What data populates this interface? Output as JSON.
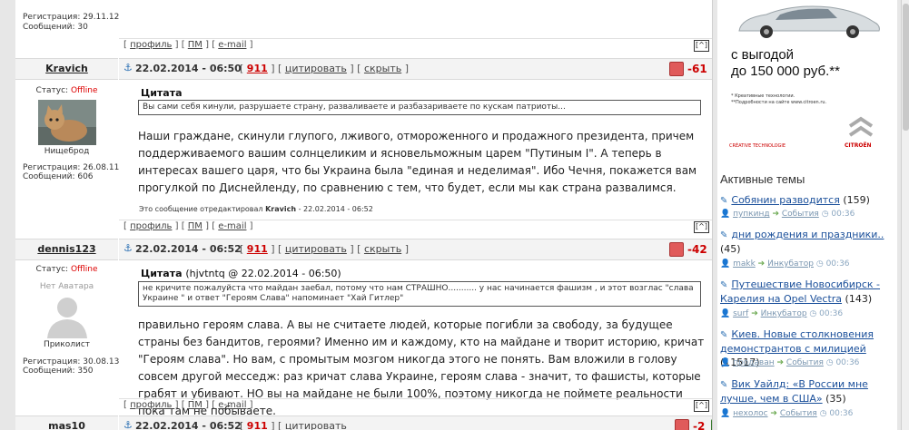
{
  "post0": {
    "reg": "Регистрация: 29.11.12",
    "msgs": "Сообщений: 30",
    "footer": {
      "profile": "профиль",
      "pm": "ПМ",
      "email": "e-mail"
    },
    "totop": "[^]"
  },
  "post1": {
    "user": "Kravich",
    "status_label": "Статус:",
    "status": "Offline",
    "rank": "Нищеброд",
    "reg": "Регистрация: 26.08.11",
    "msgs": "Сообщений: 606",
    "date": "22.02.2014 - 06:50",
    "num": "911",
    "quote_btn": "цитировать",
    "hide_btn": "скрыть",
    "rating": "-61",
    "quote_title": "Цитата",
    "quote_text": "Вы сами себя кинули, разрушаете страну, разваливаете и разбазариваете по кускам патриоты...",
    "text": "Наши граждане, скинули глупого, лживого, отмороженного и продажного президента, причем поддерживаемого вашим солнцеликим и ясновельможным царем \"Путиным I\". А теперь в интересах вашего царя, что бы Украина была \"единая и неделимая\". Ибо Чечня, покажется вам прогулкой по Диснейленду, по сравнению с тем, что будет, если мы как страна развалимся.",
    "edited_prefix": "Это сообщение отредактировал",
    "edited_user": "Kravich",
    "edited_date": "- 22.02.2014 - 06:52",
    "footer": {
      "profile": "профиль",
      "pm": "ПМ",
      "email": "e-mail"
    },
    "totop": "[^]"
  },
  "post2": {
    "user": "dennis123",
    "status_label": "Статус:",
    "status": "Offline",
    "avatar_label": "Нет Аватара",
    "rank": "Приколист",
    "reg": "Регистрация: 30.08.13",
    "msgs": "Сообщений: 350",
    "date": "22.02.2014 - 06:52",
    "num": "911",
    "quote_btn": "цитировать",
    "hide_btn": "скрыть",
    "rating": "-42",
    "quote_title": "Цитата",
    "quote_author": "(hjvtntq @ 22.02.2014 - 06:50)",
    "quote_text": "не кричите пожалуйста что майдан заебал, потому что нам СТРАШНО........... у нас начинается фашизм , и этот возглас \"слава Украине \" и ответ \"Героям Слава\" напоминает \"Хай Гитлер\"",
    "text": "правильно героям слава. А вы не считаете людей, которые погибли за свободу, за будущее страны без бандитов, героями? Именно им и каждому, кто на майдане и творит историю, кричат \"Героям слава\". Но вам, с промытым мозгом никогда этого не понять. Вам вложили в голову совсем другой месседж: раз кричат слава Украине, героям слава - значит, то фашисты, которые грабят и убивают. НО вы на майдане не были 100%, поэтому никогда не поймете реальности пока там не побываете.",
    "footer": {
      "profile": "профиль",
      "pm": "ПМ",
      "email": "e-mail"
    },
    "totop": "[^]"
  },
  "post3": {
    "user": "mas10",
    "date": "22.02.2014 - 06:52",
    "num": "911",
    "quote_btn": "цитировать",
    "rating": "-2"
  },
  "ad": {
    "line1": "с выгодой",
    "line2": "до 150 000 руб.**",
    "small1": "* Креативные технологии.",
    "small2": "**Подробности на сайте www.citroen.ru.",
    "creative": "CRÉATIVE TECHNOLOGIE",
    "brand": "CITROËN"
  },
  "sidebar": {
    "heading": "Активные темы",
    "topics": [
      {
        "title": "Собянин разводится",
        "count": "(159)",
        "user": "пупкинд",
        "section": "События",
        "time": "00:36"
      },
      {
        "title": "дни рождения и праздники..",
        "count": "(45)",
        "user": "makk",
        "section": "Инкубатор",
        "time": "00:36"
      },
      {
        "title": "Путешествие Новосибирск - Карелия на Opel Vectra",
        "count": "(143)",
        "user": "surf",
        "section": "Инкубатор",
        "time": "00:36"
      },
      {
        "title": "Киев. Новые столкновения демонстрантов с милицией",
        "count": "(11517)",
        "user": "продаван",
        "section": "События",
        "time": "00:36"
      },
      {
        "title": "Вик Уайлд: «В России мне лучше, чем в США»",
        "count": "(35)",
        "user": "нехолос",
        "section": "События",
        "time": "00:36"
      }
    ]
  },
  "colors": {
    "accent": "#1a4f9a",
    "offline": "#dd0000",
    "rating": "#cc0000",
    "down": "#e05a5a",
    "up": "#5eaa52"
  }
}
